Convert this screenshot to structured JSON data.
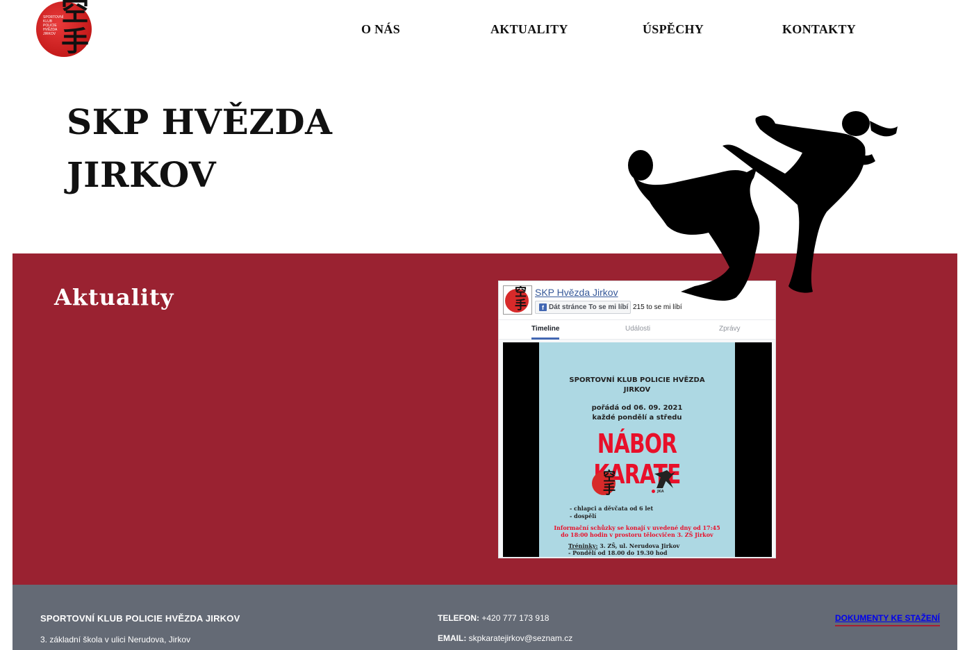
{
  "header": {
    "logo": {
      "kanji": "空手",
      "small_text": "SPORTOVNÍ KLUB POLICIE HVĚZDA JIRKOV"
    },
    "nav": [
      {
        "label": "O NÁS"
      },
      {
        "label": "AKTUALITY"
      },
      {
        "label": "ÚSPĚCHY"
      },
      {
        "label": "KONTAKTY"
      }
    ]
  },
  "hero": {
    "title_line1": "SKP HVĚZDA",
    "title_line2": "JIRKOV"
  },
  "news": {
    "title": "Aktuality",
    "facebook": {
      "page_name": "SKP Hvězda Jirkov",
      "like_button": "Dát stránce To se mi líbí",
      "like_count": "215 to se mi líbí",
      "tabs": [
        "Timeline",
        "Události",
        "Zprávy"
      ],
      "post": {
        "org_line1": "SPORTOVNÍ KLUB POLICIE HVĚZDA",
        "org_line2": "JIRKOV",
        "date_line1": "pořádá od 06. 09. 2021",
        "date_line2": "každé pondělí a středu",
        "headline": "NÁBOR KARATE",
        "logo2_text": "JKA",
        "list": [
          "-  chlapci a děvčata od 6 let",
          "-  dospělí"
        ],
        "info_line1": "Informační schůzky se konají v uvedené dny od 17:45",
        "info_line2": "do 18:00 hodin v prostoru tělocvičen 3. ZŠ Jirkov",
        "training_label": "Tréninky:",
        "training_place": "3. ZŠ, ul. Nerudova Jirkov",
        "training_time": "-  Pondělí od 18.00 do 19.30 hod"
      }
    }
  },
  "footer": {
    "org": "SPORTOVNÍ KLUB POLICIE HVĚZDA JIRKOV",
    "address": "3. základní škola v ulici Nerudova, Jirkov",
    "phone_label": "TELEFON:",
    "phone": "+420 777 173 918",
    "email_label": "EMAIL:",
    "email": "skpkaratejirkov@seznam.cz",
    "docs_link": "DOKUMENTY KE STAŽENÍ"
  },
  "colors": {
    "accent_red": "#9a2231",
    "footer_gray": "#646a75",
    "fb_blue": "#365899"
  }
}
